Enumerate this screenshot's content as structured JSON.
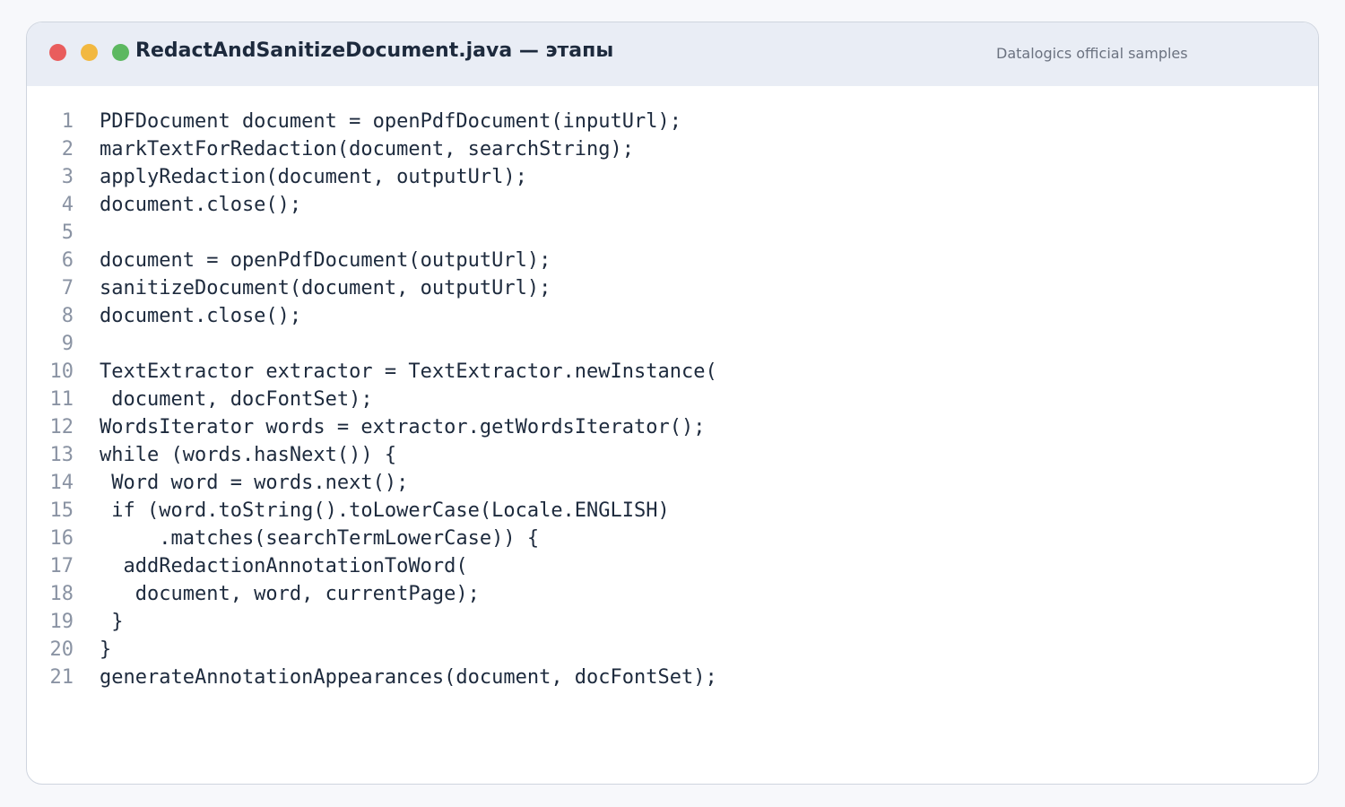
{
  "window": {
    "title": "RedactAndSanitizeDocument.java — этапы",
    "source_label": "Datalogics official samples",
    "controls": [
      {
        "name": "close",
        "color": "#e95d5d"
      },
      {
        "name": "minimize",
        "color": "#f2b840"
      },
      {
        "name": "maximize",
        "color": "#5cb860"
      }
    ]
  },
  "code": {
    "lines": [
      {
        "n": "1",
        "text": "PDFDocument document = openPdfDocument(inputUrl);"
      },
      {
        "n": "2",
        "text": "markTextForRedaction(document, searchString);"
      },
      {
        "n": "3",
        "text": "applyRedaction(document, outputUrl);"
      },
      {
        "n": "4",
        "text": "document.close();"
      },
      {
        "n": "5",
        "text": ""
      },
      {
        "n": "6",
        "text": "document = openPdfDocument(outputUrl);"
      },
      {
        "n": "7",
        "text": "sanitizeDocument(document, outputUrl);"
      },
      {
        "n": "8",
        "text": "document.close();"
      },
      {
        "n": "9",
        "text": ""
      },
      {
        "n": "10",
        "text": "TextExtractor extractor = TextExtractor.newInstance("
      },
      {
        "n": "11",
        "text": " document, docFontSet);"
      },
      {
        "n": "12",
        "text": "WordsIterator words = extractor.getWordsIterator();"
      },
      {
        "n": "13",
        "text": "while (words.hasNext()) {"
      },
      {
        "n": "14",
        "text": " Word word = words.next();"
      },
      {
        "n": "15",
        "text": " if (word.toString().toLowerCase(Locale.ENGLISH)"
      },
      {
        "n": "16",
        "text": "     .matches(searchTermLowerCase)) {"
      },
      {
        "n": "17",
        "text": "  addRedactionAnnotationToWord("
      },
      {
        "n": "18",
        "text": "   document, word, currentPage);"
      },
      {
        "n": "19",
        "text": " }"
      },
      {
        "n": "20",
        "text": "}"
      },
      {
        "n": "21",
        "text": "generateAnnotationAppearances(document, docFontSet);"
      }
    ]
  }
}
